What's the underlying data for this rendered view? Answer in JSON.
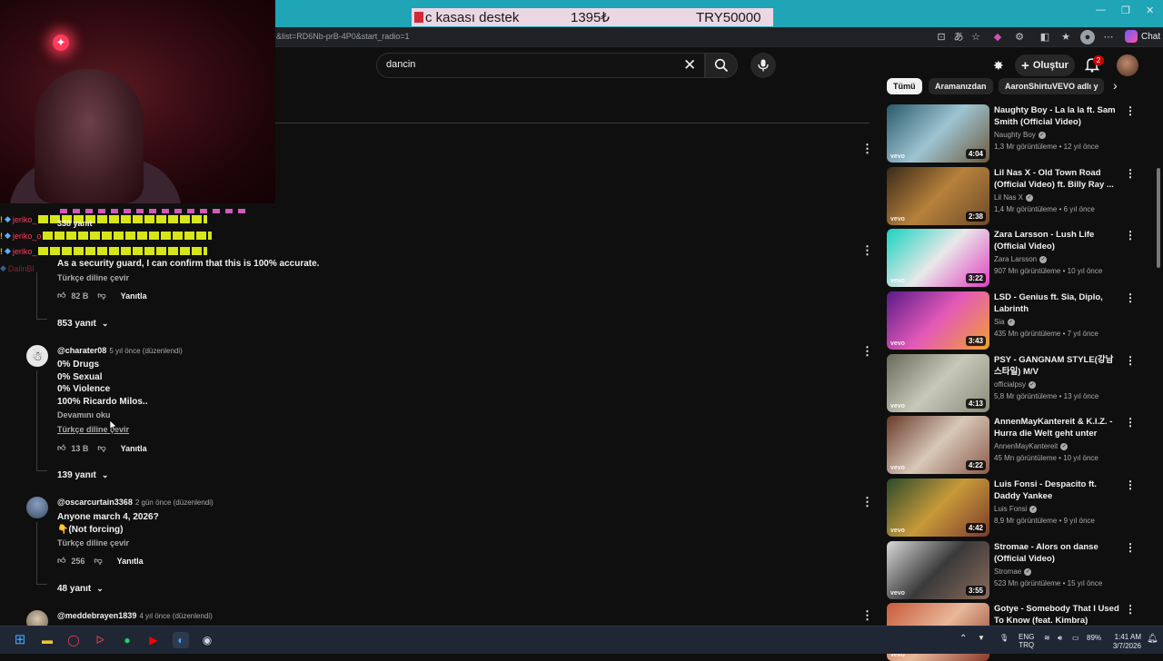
{
  "overlay": {
    "donation": {
      "label": "c kasası destek",
      "current": "1395₺",
      "goal": "TRY50000"
    },
    "chat": [
      {
        "name": "jeriko_",
        "warn": "!",
        "emotes": true
      },
      {
        "name": "jeriko_o",
        "warn": "!",
        "emotes": true
      },
      {
        "name": "jeriko_",
        "warn": "!",
        "emotes": true
      },
      {
        "name": "DalinBl",
        "warn": "",
        "emotes": false
      }
    ]
  },
  "browser": {
    "url": "&list=RD6Nb-prB-4P0&start_radio=1",
    "chat_label": "Chat"
  },
  "youtube": {
    "search": {
      "query": "dancin"
    },
    "create_label": "Oluştur",
    "notification_count": "2"
  },
  "comments": {
    "partial_first": {
      "reply_count_top": "338 yanıt",
      "text": "As a security guard, I can confirm that this is 100% accurate.",
      "translate": "Türkçe diline çevir",
      "likes": "82 B",
      "reply_label": "Yanıtla",
      "replies_toggle": "853 yanıt"
    },
    "items": [
      {
        "handle": "@charater08",
        "meta": "5 yıl önce (düzenlendi)",
        "lines": [
          "0% Drugs",
          "0% Sexual",
          "0% Violence",
          "100% Ricardo Milos.."
        ],
        "read_more": "Devamını oku",
        "translate": "Türkçe diline çevir",
        "likes": "13 B",
        "reply_label": "Yanıtla",
        "replies_toggle": "139 yanıt"
      },
      {
        "handle": "@oscarcurtain3368",
        "meta": "2 gün önce (düzenlendi)",
        "lines": [
          "Anyone march 4, 2026?",
          "👇(Not forcing)"
        ],
        "translate": "Türkçe diline çevir",
        "likes": "256",
        "reply_label": "Yanıtla",
        "replies_toggle": "48 yanıt"
      },
      {
        "handle": "@meddebrayen1839",
        "meta": "4 yıl önce (düzenlendi)"
      }
    ]
  },
  "sidebar": {
    "chips": [
      "Tümü",
      "Aramanızdan",
      "AaronShirtuVEVO adlı y"
    ],
    "videos": [
      {
        "title": "Naughty Boy - La la la ft. Sam Smith (Official Video)",
        "channel": "Naughty Boy",
        "stats": "1,3 Mr görüntüleme • 12 yıl önce",
        "duration": "4:04",
        "colors": [
          "#2a5a6a",
          "#9ec4d2",
          "#6d5a3e"
        ]
      },
      {
        "title": "Lil Nas X - Old Town Road (Official Video) ft. Billy Ray ...",
        "channel": "Lil Nas X",
        "stats": "1,4 Mr görüntüleme • 6 yıl önce",
        "duration": "2:38",
        "colors": [
          "#3a2a1a",
          "#b7813b",
          "#6b4a2a"
        ]
      },
      {
        "title": "Zara Larsson - Lush Life (Official Video)",
        "channel": "Zara Larsson",
        "stats": "907 Mn görüntüleme • 10 yıl önce",
        "duration": "3:22",
        "colors": [
          "#18d3c0",
          "#e8e8e8",
          "#e040c0"
        ]
      },
      {
        "title": "LSD - Genius ft. Sia, Diplo, Labrinth",
        "channel": "Sia",
        "stats": "435 Mn görüntüleme • 7 yıl önce",
        "duration": "3:43",
        "colors": [
          "#5a1a8a",
          "#e45ab8",
          "#f0a030"
        ]
      },
      {
        "title": "PSY - GANGNAM STYLE(강남스타일) M/V",
        "channel": "officialpsy",
        "stats": "5,8 Mr görüntüleme • 13 yıl önce",
        "duration": "4:13",
        "colors": [
          "#6a6a5a",
          "#c8c8b8",
          "#8a8a7a"
        ]
      },
      {
        "title": "AnnenMayKantereit & K.I.Z. - Hurra die Welt geht unter",
        "channel": "AnnenMayKantereit",
        "stats": "45 Mn görüntüleme • 10 yıl önce",
        "duration": "4:22",
        "colors": [
          "#6a3a2a",
          "#d8c8b8",
          "#8a5a4a"
        ]
      },
      {
        "title": "Luis Fonsi - Despacito ft. Daddy Yankee",
        "channel": "Luis Fonsi",
        "stats": "8,9 Mr görüntüleme • 9 yıl önce",
        "duration": "4:42",
        "colors": [
          "#2a4a2a",
          "#c89a3a",
          "#7a3a2a"
        ]
      },
      {
        "title": "Stromae - Alors on danse (Official Video)",
        "channel": "Stromae",
        "stats": "523 Mn görüntüleme • 15 yıl önce",
        "duration": "3:55",
        "colors": [
          "#d8d8d8",
          "#3a3a3a",
          "#8a6a5a"
        ]
      },
      {
        "title": "Gotye - Somebody That I Used To Know (feat. Kimbra) [Offici...",
        "channel": "",
        "stats": "",
        "duration": "",
        "colors": [
          "#c85a3a",
          "#e8b89a",
          "#8a3a2a"
        ]
      }
    ]
  },
  "taskbar": {
    "lang": "ENG",
    "lang2": "TRQ",
    "battery": "89%",
    "time": "1:41 AM",
    "date": "3/7/2026"
  }
}
